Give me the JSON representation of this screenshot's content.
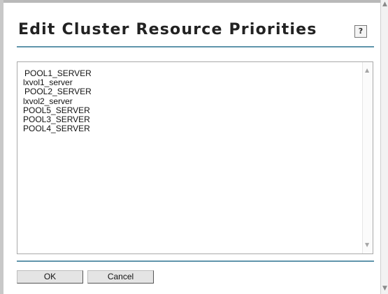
{
  "dialog": {
    "title": "Edit Cluster Resource Priorities",
    "help_label": "?"
  },
  "list": {
    "items": [
      {
        "label": "POOL1_SERVER"
      },
      {
        "label": "lxvol1_server"
      },
      {
        "label": "POOL2_SERVER"
      },
      {
        "label": "lxvol2_server"
      },
      {
        "label": "POOL5_SERVER"
      },
      {
        "label": "POOL3_SERVER"
      },
      {
        "label": "POOL4_SERVER"
      }
    ]
  },
  "buttons": {
    "ok_label": "OK",
    "cancel_label": "Cancel"
  },
  "icons": {
    "scroll_up": "▲",
    "scroll_down": "▼"
  },
  "colors": {
    "rule": "#5f95ab",
    "button_face": "#e4e4e4"
  }
}
